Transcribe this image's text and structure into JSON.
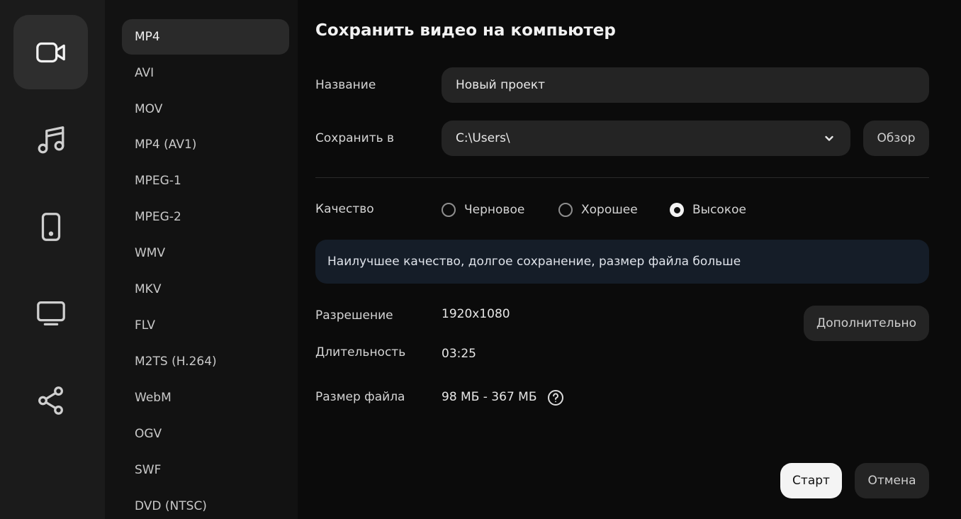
{
  "sidebar": {
    "items": [
      {
        "icon": "video-camera-icon",
        "active": true
      },
      {
        "icon": "music-note-icon",
        "active": false
      },
      {
        "icon": "mobile-phone-icon",
        "active": false
      },
      {
        "icon": "tv-monitor-icon",
        "active": false
      },
      {
        "icon": "share-icon",
        "active": false
      }
    ]
  },
  "formats": {
    "selected": "MP4",
    "items": [
      "MP4",
      "AVI",
      "MOV",
      "MP4 (AV1)",
      "MPEG-1",
      "MPEG-2",
      "WMV",
      "MKV",
      "FLV",
      "M2TS (H.264)",
      "WebM",
      "OGV",
      "SWF",
      "DVD (NTSC)"
    ]
  },
  "main": {
    "title": "Сохранить видео на компьютер",
    "name_label": "Название",
    "name_value": "Новый проект",
    "save_to_label": "Сохранить в",
    "save_to_value": "C:\\Users\\",
    "browse_label": "Обзор",
    "quality_label": "Качество",
    "quality_options": [
      {
        "label": "Черновое",
        "checked": false
      },
      {
        "label": "Хорошее",
        "checked": false
      },
      {
        "label": "Высокое",
        "checked": true
      }
    ],
    "quality_info": "Наилучшее качество, долгое сохранение, размер файла больше",
    "resolution_label": "Разрешение",
    "resolution_value": "1920x1080",
    "advanced_label": "Дополнительно",
    "duration_label": "Длительность",
    "duration_value": "03:25",
    "filesize_label": "Размер файла",
    "filesize_value": "98 МБ - 367 МБ",
    "start_label": "Старт",
    "cancel_label": "Отмена"
  },
  "colors": {
    "rail_bg": "#1b1b1b",
    "list_bg": "#121212",
    "main_bg": "#0b0b0b",
    "info_bg": "#151d28",
    "primary_button": "#f4f4f4"
  }
}
